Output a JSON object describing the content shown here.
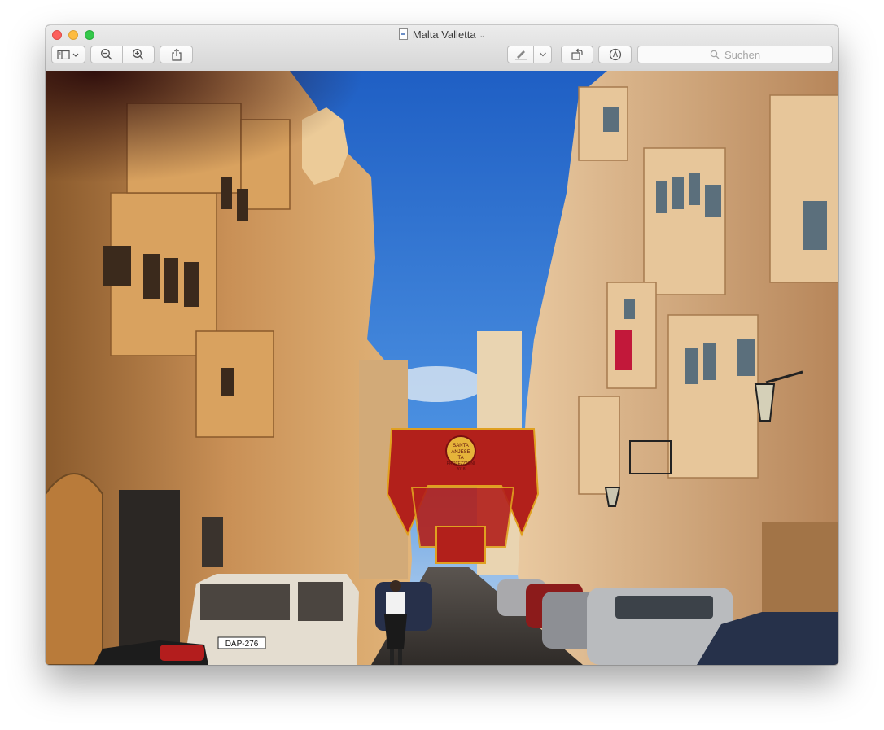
{
  "window": {
    "title": "Malta Valletta",
    "title_icon": "document-icon",
    "title_menu_icon": "chevron-down-icon"
  },
  "toolbar": {
    "sidebar_button_icon": "sidebar-icon",
    "zoom_out_icon": "zoom-out-icon",
    "zoom_in_icon": "zoom-in-icon",
    "share_icon": "share-icon",
    "markup_pen_icon": "pen-icon",
    "rotate_icon": "rotate-icon",
    "annotate_icon": "markup-icon"
  },
  "search": {
    "placeholder": "Suchen"
  },
  "photo": {
    "description_icon": "photo",
    "plate_text": "DAP-276",
    "banner_text_1": "SANTA",
    "banner_text_2": "ANJESE",
    "banner_text_3": "TA",
    "banner_text_4": "PROTEZZJONI",
    "banner_text_5": "2018"
  },
  "colors": {
    "close": "#fc605c",
    "minimize": "#fdbc40",
    "maximize": "#34c84a",
    "sky": "#2a6fd0",
    "stone": "#c9955a",
    "banner": "#b2201b"
  }
}
